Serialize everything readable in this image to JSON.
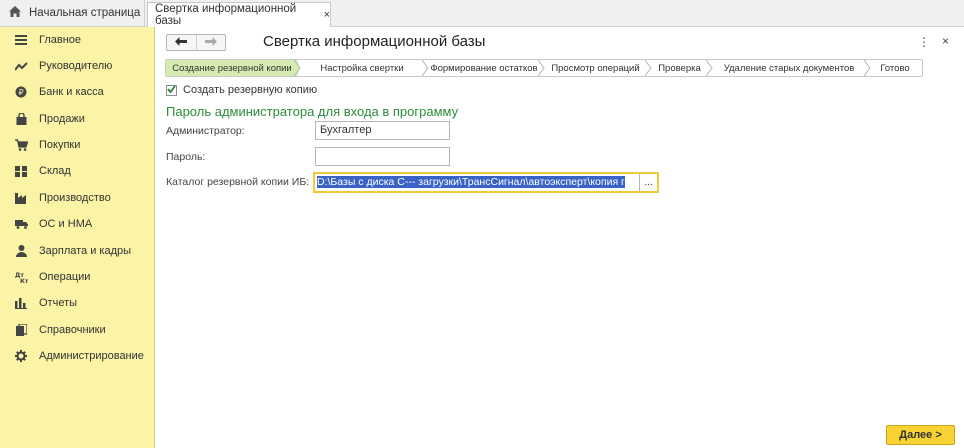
{
  "top_tabs": {
    "home_label": "Начальная страница",
    "active_label": "Свертка информационной базы",
    "close_glyph": "×"
  },
  "sidebar": {
    "items": [
      {
        "label": "Главное",
        "icon": "menu-icon"
      },
      {
        "label": "Руководителю",
        "icon": "trend-icon"
      },
      {
        "label": "Банк и касса",
        "icon": "coin-icon"
      },
      {
        "label": "Продажи",
        "icon": "bag-icon"
      },
      {
        "label": "Покупки",
        "icon": "cart-icon"
      },
      {
        "label": "Склад",
        "icon": "warehouse-icon"
      },
      {
        "label": "Производство",
        "icon": "factory-icon"
      },
      {
        "label": "ОС и НМА",
        "icon": "truck-icon"
      },
      {
        "label": "Зарплата и кадры",
        "icon": "person-icon"
      },
      {
        "label": "Операции",
        "icon": "dt-kt-icon"
      },
      {
        "label": "Отчеты",
        "icon": "bar-chart-icon"
      },
      {
        "label": "Справочники",
        "icon": "books-icon"
      },
      {
        "label": "Администрирование",
        "icon": "gear-icon"
      }
    ]
  },
  "header": {
    "title": "Свертка информационной базы",
    "more_glyph": "⋮",
    "close_glyph": "×"
  },
  "steps": [
    {
      "label": "Создание резервной копии",
      "active": true
    },
    {
      "label": "Настройка свертки",
      "active": false
    },
    {
      "label": "Формирование остатков",
      "active": false
    },
    {
      "label": "Просмотр операций",
      "active": false
    },
    {
      "label": "Проверка",
      "active": false
    },
    {
      "label": "Удаление старых документов",
      "active": false
    },
    {
      "label": "Готово",
      "active": false
    }
  ],
  "form": {
    "backup_checkbox_label": "Создать резервную копию",
    "backup_checked": true,
    "section_title": "Пароль администратора для входа в программу",
    "admin_label": "Администратор:",
    "admin_value": "Бухгалтер",
    "password_label": "Пароль:",
    "password_value": "",
    "catalog_label": "Каталог резервной копии ИБ:",
    "catalog_value": "D:\\Базы с диска С--- загрузки\\ТрансСигнал\\автоэксперт\\копия г",
    "browse_glyph": "..."
  },
  "footer": {
    "next_label": "Далее >"
  },
  "colors": {
    "sidebar_bg": "#fbf3a5",
    "accent_green": "#2e8b3d",
    "active_step": "#d6ebb0",
    "next_button": "#f7d233",
    "focus_border": "#f0cc38",
    "selection": "#3a63c7"
  }
}
